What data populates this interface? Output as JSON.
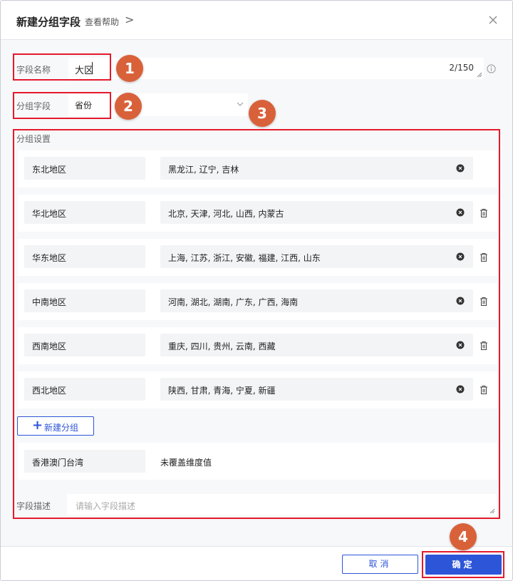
{
  "dialog": {
    "title": "新建分组字段",
    "help_link": "查看帮助",
    "help_chevron": ">",
    "close_icon": "close-icon"
  },
  "field_name": {
    "label": "字段名称",
    "value": "大区",
    "counter": "2/150"
  },
  "group_field": {
    "label": "分组字段",
    "value": "省份"
  },
  "group_settings": {
    "label": "分组设置",
    "groups": [
      {
        "name": "东北地区",
        "values": "黑龙江, 辽宁, 吉林",
        "deletable": false
      },
      {
        "name": "华北地区",
        "values": "北京, 天津, 河北, 山西, 内蒙古",
        "deletable": true
      },
      {
        "name": "华东地区",
        "values": "上海, 江苏, 浙江, 安徽, 福建, 江西, 山东",
        "deletable": true
      },
      {
        "name": "中南地区",
        "values": "河南, 湖北, 湖南, 广东, 广西, 海南",
        "deletable": true
      },
      {
        "name": "西南地区",
        "values": "重庆, 四川, 贵州, 云南, 西藏",
        "deletable": true
      },
      {
        "name": "西北地区",
        "values": "陕西, 甘肃, 青海, 宁夏, 新疆",
        "deletable": true
      }
    ],
    "new_group_label": "新建分组",
    "uncovered": {
      "name": "香港澳门台湾",
      "value": "未覆盖维度值"
    }
  },
  "description": {
    "label": "字段描述",
    "placeholder": "请输入字段描述"
  },
  "footer": {
    "cancel_label": "取消",
    "ok_label": "确定"
  },
  "annotations": [
    "1",
    "2",
    "3",
    "4"
  ],
  "colors": {
    "accent": "#2d55d8",
    "highlight": "#e5192b",
    "badge": "#d9613a"
  }
}
